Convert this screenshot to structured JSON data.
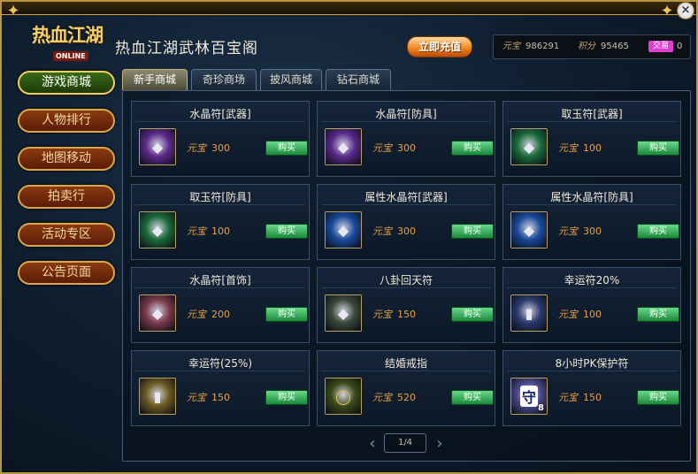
{
  "header": {
    "logo_main": "热血江湖",
    "logo_sub": "ONLINE",
    "title": "热血江湖武林百宝阁",
    "recharge_label": "立即充值"
  },
  "currency": {
    "yuanbao_label": "元宝",
    "yuanbao_value": "986291",
    "points_label": "积分",
    "points_value": "95465",
    "trade_label": "交易",
    "trade_value": "0"
  },
  "sidebar": {
    "items": [
      {
        "label": "游戏商城",
        "active": true
      },
      {
        "label": "人物排行",
        "active": false
      },
      {
        "label": "地图移动",
        "active": false
      },
      {
        "label": "拍卖行",
        "active": false
      },
      {
        "label": "活动专区",
        "active": false
      },
      {
        "label": "公告页面",
        "active": false
      }
    ]
  },
  "tabs": [
    {
      "label": "新手商城",
      "active": true
    },
    {
      "label": "奇珍商场",
      "active": false
    },
    {
      "label": "披风商城",
      "active": false
    },
    {
      "label": "钻石商城",
      "active": false
    }
  ],
  "products": [
    {
      "name": "水晶符[武器]",
      "currency": "元宝",
      "price": "300",
      "buy": "购买",
      "icon": "crystal-talisman-purple-icon",
      "color": "#5a2a8a"
    },
    {
      "name": "水晶符[防具]",
      "currency": "元宝",
      "price": "300",
      "buy": "购买",
      "icon": "crystal-talisman-purple-icon",
      "color": "#5a2a8a"
    },
    {
      "name": "取玉符[武器]",
      "currency": "元宝",
      "price": "100",
      "buy": "购买",
      "icon": "jade-talisman-green-icon",
      "color": "#1a6a3a"
    },
    {
      "name": "取玉符[防具]",
      "currency": "元宝",
      "price": "100",
      "buy": "购买",
      "icon": "jade-talisman-green-icon",
      "color": "#1a6a3a"
    },
    {
      "name": "属性水晶符[武器]",
      "currency": "元宝",
      "price": "300",
      "buy": "购买",
      "icon": "attribute-talisman-blue-icon",
      "color": "#1a4a9a"
    },
    {
      "name": "属性水晶符[防具]",
      "currency": "元宝",
      "price": "300",
      "buy": "购买",
      "icon": "attribute-talisman-blue-icon",
      "color": "#1a4a9a"
    },
    {
      "name": "水晶符[首饰]",
      "currency": "元宝",
      "price": "200",
      "buy": "购买",
      "icon": "crystal-talisman-pink-icon",
      "color": "#7a3a4a"
    },
    {
      "name": "八卦回天符",
      "currency": "元宝",
      "price": "150",
      "buy": "购买",
      "icon": "bagua-talisman-icon",
      "color": "#3a4a3a"
    },
    {
      "name": "幸运符20%",
      "currency": "元宝",
      "price": "100",
      "buy": "购买",
      "icon": "lucky-charm-scroll-icon",
      "color": "#2a3a6a"
    },
    {
      "name": "幸运符(25%)",
      "currency": "元宝",
      "price": "150",
      "buy": "购买",
      "icon": "lucky-charm-scroll-icon",
      "color": "#6a5a20"
    },
    {
      "name": "结婚戒指",
      "currency": "元宝",
      "price": "520",
      "buy": "购买",
      "icon": "wedding-ring-icon",
      "color": "#3a4a18"
    },
    {
      "name": "8小时PK保护符",
      "currency": "元宝",
      "price": "150",
      "buy": "购买",
      "icon": "pk-protection-shield-icon",
      "color": "#4a4a8a"
    }
  ],
  "pager": {
    "text": "1/4",
    "prev": "‹",
    "next": "›"
  },
  "icon_glyphs": {
    "pk_badge": "守",
    "pk_count": "8"
  }
}
